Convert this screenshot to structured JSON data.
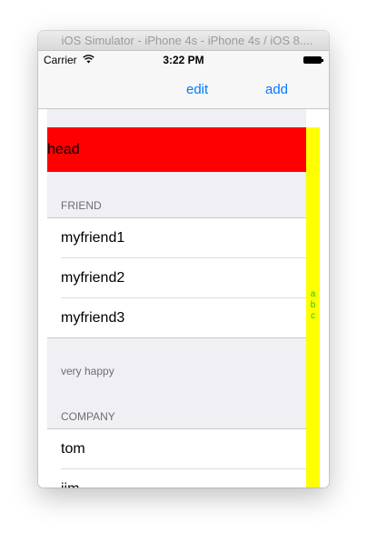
{
  "window": {
    "title": "iOS Simulator - iPhone 4s - iPhone 4s / iOS 8...."
  },
  "status_bar": {
    "carrier": "Carrier",
    "time": "3:22 PM"
  },
  "nav_bar": {
    "edit_label": "edit",
    "add_label": "add"
  },
  "table": {
    "head_text": "head",
    "sections": [
      {
        "header": "FRIEND",
        "rows": [
          "myfriend1",
          "myfriend2",
          "myfriend3"
        ],
        "footer": "very happy"
      },
      {
        "header": "COMPANY",
        "rows": [
          "tom",
          "jim"
        ]
      }
    ]
  },
  "index_bar": {
    "letters": [
      "a",
      "b",
      "c"
    ]
  },
  "colors": {
    "tint": "#007aff",
    "head_background": "#ff0000",
    "index_background": "#ffff00",
    "index_text": "#1ec81e",
    "grouped_background": "#efeff4"
  }
}
